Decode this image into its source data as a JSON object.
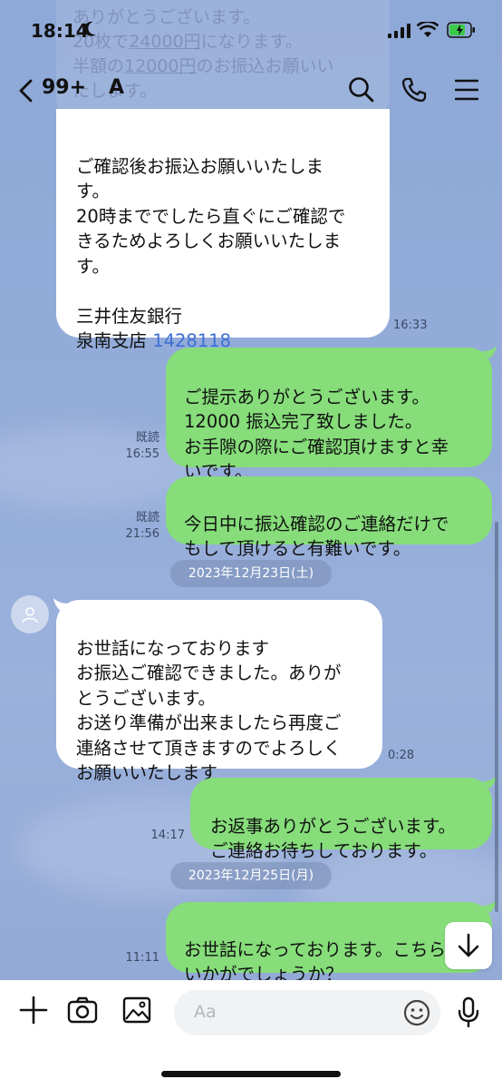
{
  "status_bar": {
    "time": "18:14"
  },
  "header": {
    "unread_count": "99+",
    "contact_name": "A"
  },
  "ghost_quote": {
    "line1": "ありがとうございます。",
    "line2_prefix": "20枚で",
    "line2_amount": "24000円",
    "line2_suffix": "になります。",
    "line3_prefix": "半額の",
    "line3_amount": "12000円",
    "line3_suffix": "のお振込お願いい",
    "line4": "たします。"
  },
  "messages": [
    {
      "text": "ご確認後お振込お願いいたしま\nす。\n20時まででしたら直ぐにご確認で\nきるためよろしくお願いいたしま\nす。\n\n三井住友銀行\n泉南支店 ",
      "link": "1428118",
      "time": "16:33"
    },
    {
      "text": "ご提示ありがとうございます。\n12000 振込完了致しました。\nお手隙の際にご確認頂けますと幸\nいです。",
      "read": "既読",
      "time": "16:55"
    },
    {
      "text": "今日中に振込確認のご連絡だけで\nもして頂けると有難いです。",
      "read": "既読",
      "time": "21:56"
    },
    {
      "text": "お世話になっております\nお振込ご確認できました。ありが\nとうございます。\nお送り準備が出来ましたら再度ご\n連絡させて頂きますのでよろしく\nお願いいたします",
      "time": "0:28"
    },
    {
      "text": "お返事ありがとうございます。\nご連絡お待ちしております。",
      "time": "14:17"
    },
    {
      "text": "お世話になっております。こちら\nいかがでしょうか？",
      "time": "11:11"
    }
  ],
  "dates": [
    "2023年12月23日(土)",
    "2023年12月25日(月)"
  ],
  "input": {
    "placeholder": "Aa"
  },
  "icons": [
    "back-chevron-icon",
    "search-icon",
    "phone-icon",
    "menu-icon",
    "plus-icon",
    "camera-icon",
    "image-icon",
    "emoji-icon",
    "mic-icon",
    "arrow-down-icon",
    "avatar-icon"
  ]
}
